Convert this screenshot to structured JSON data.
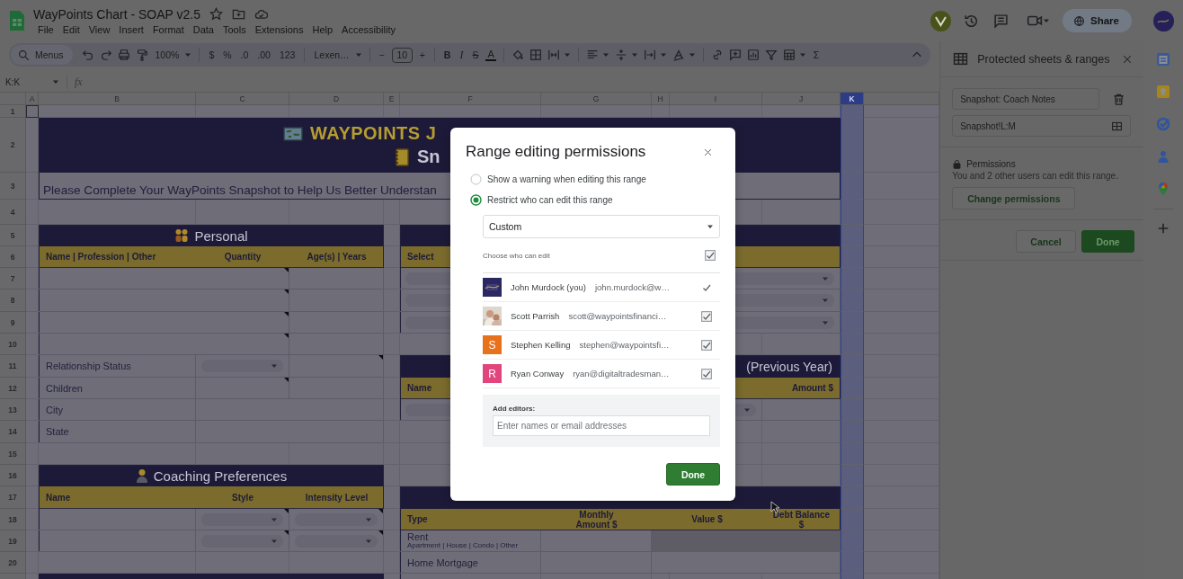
{
  "document": {
    "title": "WayPoints Chart - SOAP v2.5"
  },
  "menu": [
    "File",
    "Edit",
    "View",
    "Insert",
    "Format",
    "Data",
    "Tools",
    "Extensions",
    "Help",
    "Accessibility"
  ],
  "header_actions": {
    "share": "Share"
  },
  "toolbar": {
    "search": "Menus",
    "zoom": "100%",
    "currency": "$",
    "percent": "%",
    "decrease_decimals": ".0",
    "increase_decimals": ".00",
    "number_format": "123",
    "font": "Lexen…",
    "minus": "−",
    "font_size": "10",
    "plus": "+",
    "bold": "B",
    "italic": "I",
    "strikethrough": "S",
    "text_color": "A",
    "functions": "Σ"
  },
  "formula_bar": {
    "cell_ref": "K:K",
    "fx": "fx"
  },
  "columns": [
    {
      "label": "A",
      "selected": false
    },
    {
      "label": "B",
      "selected": false
    },
    {
      "label": "C",
      "selected": false
    },
    {
      "label": "D",
      "selected": false
    },
    {
      "label": "E",
      "selected": false
    },
    {
      "label": "F",
      "selected": false
    },
    {
      "label": "G",
      "selected": false
    },
    {
      "label": "H",
      "selected": false
    },
    {
      "label": "I",
      "selected": false
    },
    {
      "label": "J",
      "selected": false
    },
    {
      "label": "K",
      "selected": true
    }
  ],
  "rows": [
    "1",
    "2",
    "3",
    "4",
    "5",
    "6",
    "7",
    "8",
    "9",
    "10",
    "11",
    "12",
    "13",
    "14",
    "15",
    "16",
    "17",
    "18",
    "19",
    "20"
  ],
  "sheet": {
    "banner": {
      "title": "WAYPOINTS J",
      "subtitle": "Sn",
      "intro": "Please Complete Your WayPoints Snapshot to Help Us Better Understan"
    },
    "personal": {
      "title": "Personal",
      "headers": [
        "Name | Profession | Other",
        "Quantity",
        "Age(s) | Years"
      ],
      "fields": [
        "Relationship Status",
        "Children",
        "City",
        "State"
      ]
    },
    "select_block": {
      "headers": [
        "Select"
      ]
    },
    "previous_year": {
      "title": "(Previous Year)",
      "headers": [
        "Name",
        "Amount $"
      ]
    },
    "coaching": {
      "title": "Coaching Preferences",
      "headers": [
        "Name",
        "Style",
        "Intensity Level"
      ]
    },
    "expenses": {
      "headers": [
        "Type",
        "Monthly Amount $",
        "Value $",
        "Debt Balance $"
      ],
      "rows": [
        {
          "label": "Rent",
          "note": "Apartment | House | Condo | Other"
        },
        {
          "label": "Home Mortgage"
        }
      ]
    }
  },
  "panel": {
    "title": "Protected sheets & ranges",
    "description": "Snapshot: Coach Notes",
    "range": "Snapshot!L:M",
    "permissions_title": "Permissions",
    "permissions_text": "You and 2 other users can edit this range.",
    "change_button": "Change permissions",
    "cancel": "Cancel",
    "done": "Done"
  },
  "dialog": {
    "title": "Range editing permissions",
    "options": [
      {
        "label": "Show a warning when editing this range",
        "selected": false
      },
      {
        "label": "Restrict who can edit this range",
        "selected": true
      }
    ],
    "dropdown": "Custom",
    "choose_label": "Choose who can edit",
    "choose_all": true,
    "editors": [
      {
        "name": "John Murdock (you)",
        "email": "john.murdock@w…",
        "checked": true,
        "disabled": true
      },
      {
        "name": "Scott Parrish",
        "email": "scott@waypointsfinanci…",
        "checked": true,
        "disabled": false
      },
      {
        "name": "Stephen Kelling",
        "email": "stephen@waypointsfi…",
        "avatar": {
          "kind": "letter",
          "letter": "S",
          "color": "#e8711c"
        },
        "checked": true,
        "disabled": false
      },
      {
        "name": "Ryan Conway",
        "email": "ryan@digitaltradesman…",
        "avatar": {
          "kind": "letter",
          "letter": "R",
          "color": "#e0457b"
        },
        "checked": true,
        "disabled": false
      }
    ],
    "add_label": "Add editors:",
    "add_placeholder": "Enter names or email addresses",
    "done": "Done"
  }
}
